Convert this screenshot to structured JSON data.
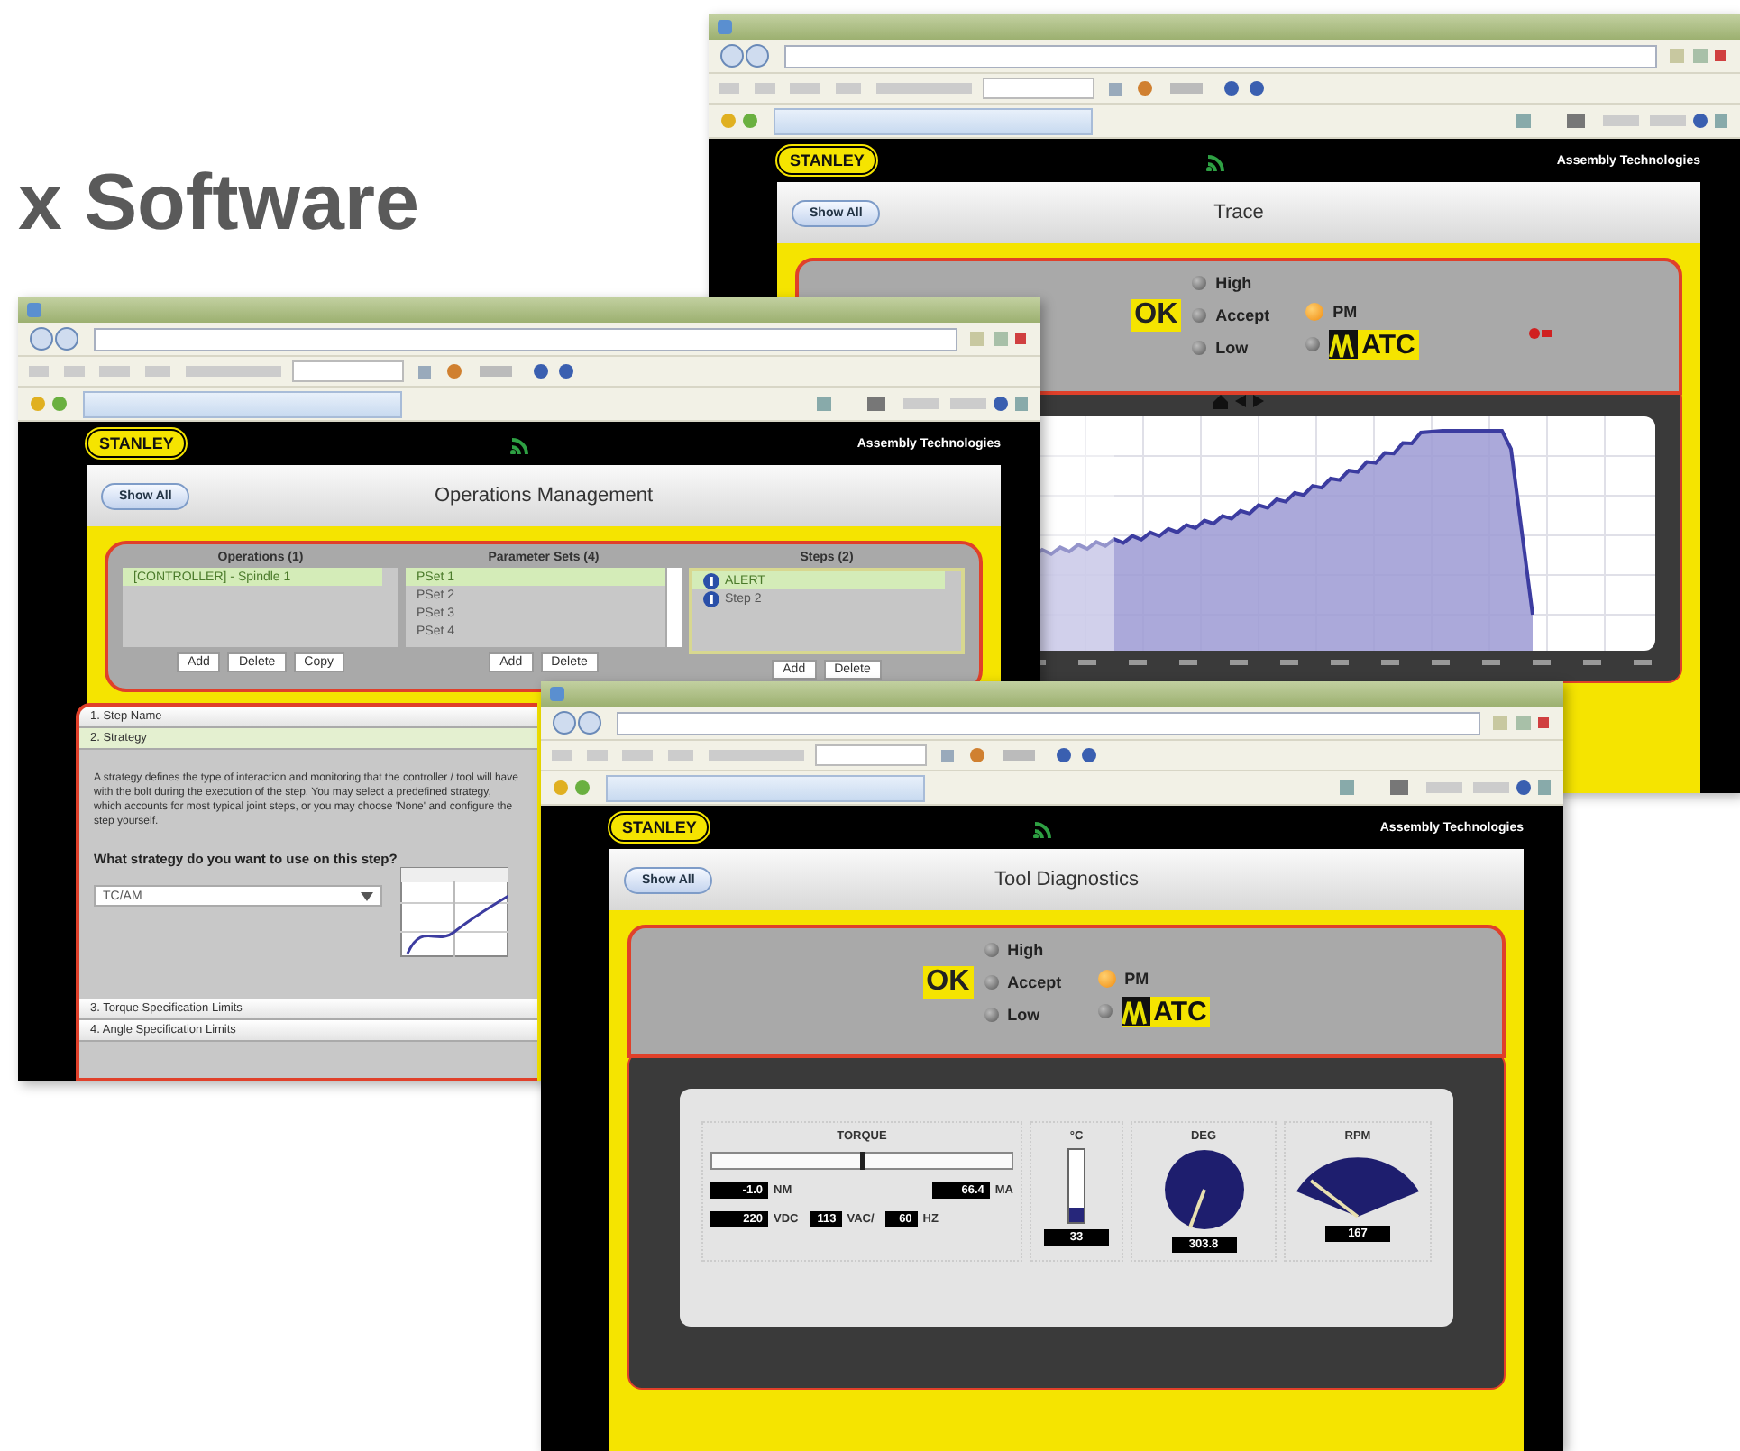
{
  "page_title": "x Software",
  "windows": [
    {
      "kind": "trace",
      "brand": "STANLEY",
      "tagline": "Assembly Technologies",
      "show_all": "Show All",
      "title": "Trace",
      "status": {
        "result": "OK",
        "levels": [
          {
            "label": "High",
            "on": false
          },
          {
            "label": "Accept",
            "on": false
          },
          {
            "label": "Low",
            "on": false
          }
        ],
        "modes": [
          {
            "label": "PM",
            "on": true,
            "kind": "text"
          },
          {
            "label": "ATC",
            "on": false,
            "kind": "logo"
          }
        ]
      }
    },
    {
      "kind": "operations",
      "brand": "STANLEY",
      "tagline": "Assembly Technologies",
      "show_all": "Show All",
      "title": "Operations Management",
      "columns": [
        {
          "heading": "Operations (1)",
          "items": [
            {
              "label": "[CONTROLLER] - Spindle 1",
              "selected": true
            }
          ],
          "buttons": [
            "Add",
            "Delete",
            "Copy"
          ]
        },
        {
          "heading": "Parameter Sets (4)",
          "items": [
            {
              "label": "PSet 1",
              "selected": true
            },
            {
              "label": "PSet 2",
              "selected": false
            },
            {
              "label": "PSet 3",
              "selected": false
            },
            {
              "label": "PSet 4",
              "selected": false
            }
          ],
          "buttons": [
            "Add",
            "Delete"
          ]
        },
        {
          "heading": "Steps (2)",
          "items": [
            {
              "label": "ALERT",
              "selected": true
            },
            {
              "label": "Step 2",
              "selected": false
            }
          ],
          "buttons": [
            "Add",
            "Delete"
          ]
        }
      ],
      "sections": [
        {
          "label": "1. Step Name",
          "expanded": false
        },
        {
          "label": "2. Strategy",
          "expanded": true,
          "description": "A strategy defines the type of interaction and monitoring that the controller / tool will have with the bolt during the execution of the step. You may select a predefined strategy, which accounts for most typical joint steps, or you may choose 'None' and configure the step yourself.",
          "question": "What strategy do you want to use on this step?",
          "strategy": {
            "value": "TC/AM"
          }
        },
        {
          "label": "3. Torque Specification Limits",
          "expanded": false
        },
        {
          "label": "4. Angle Specification Limits",
          "expanded": false
        }
      ]
    },
    {
      "kind": "diagnostics",
      "brand": "STANLEY",
      "tagline": "Assembly Technologies",
      "show_all": "Show All",
      "title": "Tool Diagnostics",
      "status": {
        "result": "OK",
        "levels": [
          {
            "label": "High",
            "on": false
          },
          {
            "label": "Accept",
            "on": false
          },
          {
            "label": "Low",
            "on": false
          }
        ],
        "modes": [
          {
            "label": "PM",
            "on": true,
            "kind": "text"
          },
          {
            "label": "ATC",
            "on": false,
            "kind": "logo"
          }
        ]
      },
      "gauges": {
        "torque": {
          "label": "TORQUE",
          "level": 0.5,
          "readings": [
            {
              "value": "-1.0",
              "unit": "NM"
            },
            {
              "value": "66.4",
              "unit": "MA"
            }
          ],
          "power": [
            {
              "value": "220",
              "unit": "VDC"
            },
            {
              "value": "113",
              "unit": "VAC/"
            },
            {
              "value": "60",
              "unit": "HZ"
            }
          ]
        },
        "temperature": {
          "label": "°C",
          "level": 0.2,
          "value": "33"
        },
        "angle": {
          "label": "DEG",
          "value": "303.8"
        },
        "speed": {
          "label": "RPM",
          "value": "167"
        }
      }
    }
  ]
}
